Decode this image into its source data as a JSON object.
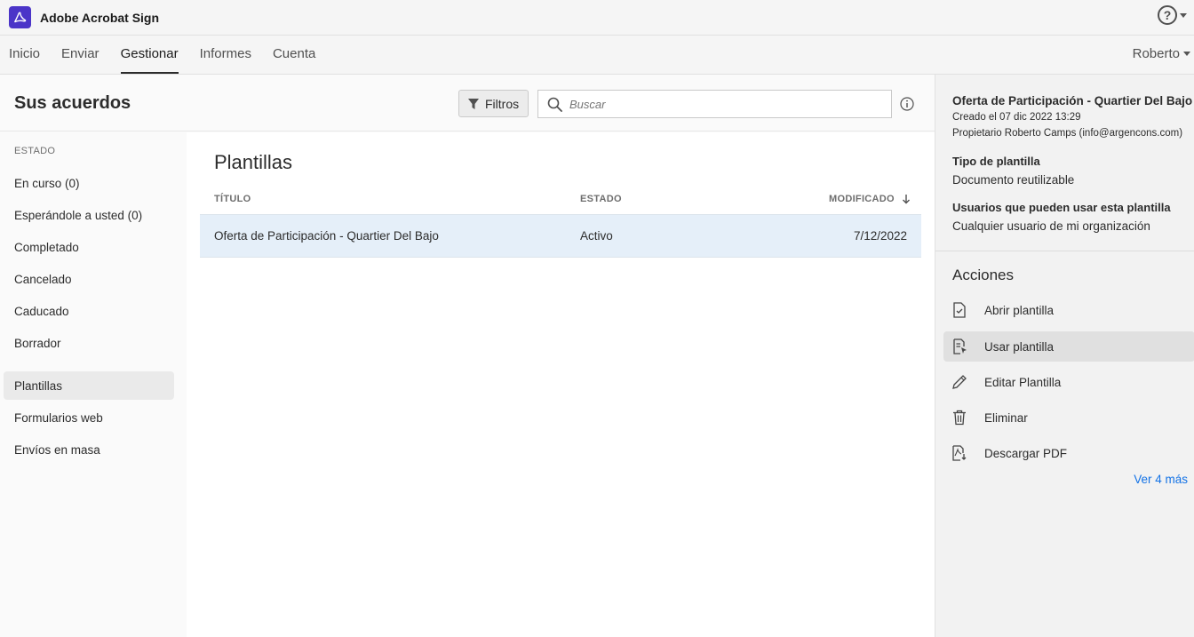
{
  "app": {
    "title": "Adobe Acrobat Sign"
  },
  "nav": {
    "tabs": [
      {
        "label": "Inicio"
      },
      {
        "label": "Enviar"
      },
      {
        "label": "Gestionar"
      },
      {
        "label": "Informes"
      },
      {
        "label": "Cuenta"
      }
    ],
    "active_tab": "Gestionar",
    "user": "Roberto"
  },
  "header": {
    "title": "Sus acuerdos",
    "filter_label": "Filtros",
    "search_placeholder": "Buscar"
  },
  "sidebar": {
    "heading": "ESTADO",
    "items": [
      {
        "label": "En curso (0)"
      },
      {
        "label": "Esperándole a usted (0)"
      },
      {
        "label": "Completado"
      },
      {
        "label": "Cancelado"
      },
      {
        "label": "Caducado"
      },
      {
        "label": "Borrador"
      },
      {
        "label": "Plantillas"
      },
      {
        "label": "Formularios web"
      },
      {
        "label": "Envíos en masa"
      }
    ],
    "selected": "Plantillas"
  },
  "content": {
    "section_title": "Plantillas",
    "columns": {
      "title": "TÍTULO",
      "status": "ESTADO",
      "modified": "MODIFICADO"
    },
    "rows": [
      {
        "title": "Oferta de Participación - Quartier Del Bajo",
        "status": "Activo",
        "modified": "7/12/2022"
      }
    ]
  },
  "details": {
    "title": "Oferta de Participación - Quartier Del Bajo",
    "created": "Creado el 07 dic 2022 13:29",
    "owner": "Propietario Roberto Camps (info@argencons.com)",
    "type_label": "Tipo de plantilla",
    "type_value": "Documento reutilizable",
    "users_label": "Usuarios que pueden usar esta plantilla",
    "users_value": "Cualquier usuario de mi organización",
    "actions_title": "Acciones",
    "actions": [
      {
        "label": "Abrir plantilla",
        "icon": "open-document-icon"
      },
      {
        "label": "Usar plantilla",
        "icon": "use-template-icon"
      },
      {
        "label": "Editar Plantilla",
        "icon": "pencil-icon"
      },
      {
        "label": "Eliminar",
        "icon": "trash-icon"
      },
      {
        "label": "Descargar PDF",
        "icon": "download-pdf-icon"
      }
    ],
    "more_link": "Ver 4 más"
  },
  "colors": {
    "brand": "#4b35c8",
    "link": "#1473e6",
    "row_selected": "#e5eff9"
  }
}
